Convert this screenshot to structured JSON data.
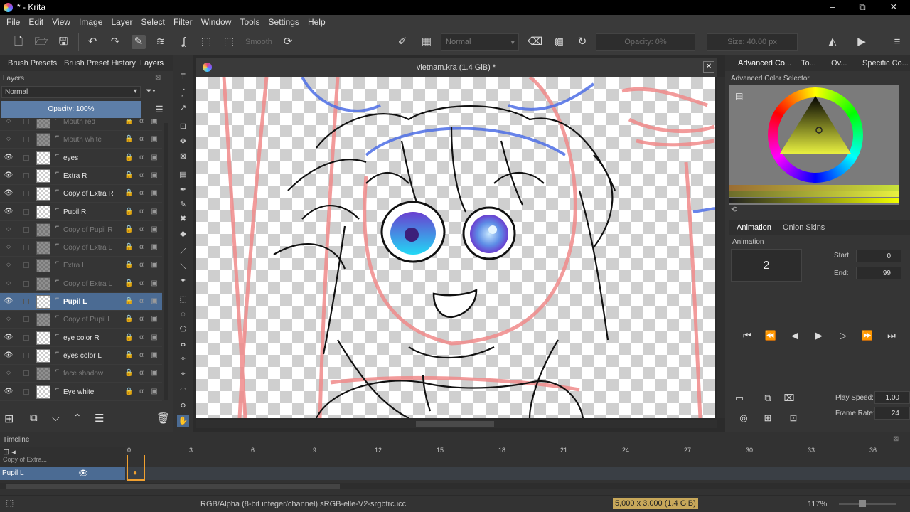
{
  "window": {
    "title": "* - Krita",
    "minimize": "–",
    "restore": "⧉",
    "close": "✕"
  },
  "menu": [
    "File",
    "Edit",
    "View",
    "Image",
    "Layer",
    "Select",
    "Filter",
    "Window",
    "Tools",
    "Settings",
    "Help"
  ],
  "toolbar": {
    "smooth_label": "Smooth",
    "blend_mode": "Normal",
    "opacity": "Opacity: 0%",
    "size": "Size: 40.00 px",
    "fg_color": "#9aa24a",
    "bg_color": "#777777"
  },
  "left_tabs": [
    "Brush Presets",
    "Brush Preset History",
    "Layers"
  ],
  "layers_panel": {
    "title": "Layers",
    "blend_mode": "Normal",
    "opacity": "Opacity:  100%",
    "layers": [
      {
        "name": "Mouth red",
        "visible": false
      },
      {
        "name": "Mouth white",
        "visible": false
      },
      {
        "name": "eyes",
        "visible": true
      },
      {
        "name": "Extra R",
        "visible": true
      },
      {
        "name": "Copy of Extra R",
        "visible": true
      },
      {
        "name": "Pupil R",
        "visible": true
      },
      {
        "name": "Copy of Pupil R",
        "visible": false
      },
      {
        "name": "Copy of Extra L",
        "visible": false
      },
      {
        "name": "Extra L",
        "visible": false
      },
      {
        "name": "Copy of Extra L",
        "visible": false
      },
      {
        "name": "Pupil L",
        "visible": true,
        "selected": true
      },
      {
        "name": "Copy of Pupil L",
        "visible": false
      },
      {
        "name": "eye color R",
        "visible": true
      },
      {
        "name": "eyes color L",
        "visible": true
      },
      {
        "name": "face shadow",
        "visible": false
      },
      {
        "name": "Eye white",
        "visible": true
      }
    ]
  },
  "document": {
    "tab_title": "vietnam.kra (1.4 GiB) *",
    "close": "✕"
  },
  "right_tabs": [
    "Advanced Co...",
    "To...",
    "Ov...",
    "Specific Co..."
  ],
  "color_selector": {
    "title": "Advanced Color Selector"
  },
  "animation": {
    "tabs": [
      "Animation",
      "Onion Skins"
    ],
    "title": "Animation",
    "current_frame": "2",
    "start_label": "Start:",
    "start": "0",
    "end_label": "End:",
    "end": "99",
    "play_speed_label": "Play Speed:",
    "play_speed": "1.00",
    "frame_rate_label": "Frame Rate:",
    "frame_rate": "24"
  },
  "timeline": {
    "title": "Timeline",
    "ticks": [
      "0",
      "3",
      "6",
      "9",
      "12",
      "15",
      "18",
      "21",
      "24",
      "27",
      "30",
      "33",
      "36"
    ],
    "rows": [
      "Copy of Extra...",
      "Pupil L"
    ]
  },
  "status": {
    "color_space": "RGB/Alpha (8-bit integer/channel)  sRGB-elle-V2-srgbtrc.icc",
    "dimensions": "5,000 x 3,000 (1.4 GiB)",
    "zoom": "117%"
  }
}
